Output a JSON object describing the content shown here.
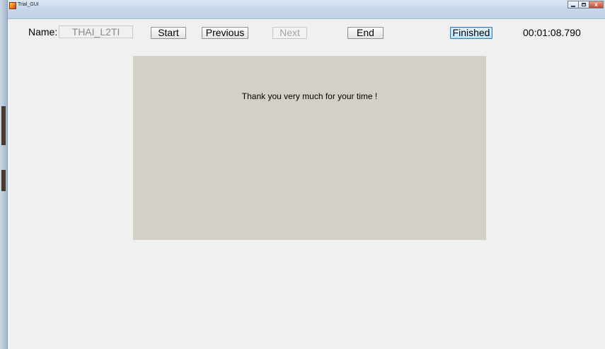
{
  "window": {
    "title": "Trial_GUI",
    "controls": {
      "minimize_icon": "minimize-icon",
      "maximize_icon": "maximize-icon",
      "close_label": "x"
    }
  },
  "header": {
    "name_label": "Name:",
    "name_value": "THAI_L2TI",
    "buttons": {
      "start": "Start",
      "previous": "Previous",
      "next": "Next",
      "end": "End",
      "finished": "Finished"
    },
    "timer": "00:01:08.790"
  },
  "panel": {
    "message": "Thank you very much for your time !",
    "background_color": "#d4d0c8"
  },
  "colors": {
    "window_background": "#f0f0f0",
    "disabled_text": "#a3a3a3",
    "focus_border": "#3c7fb1"
  }
}
